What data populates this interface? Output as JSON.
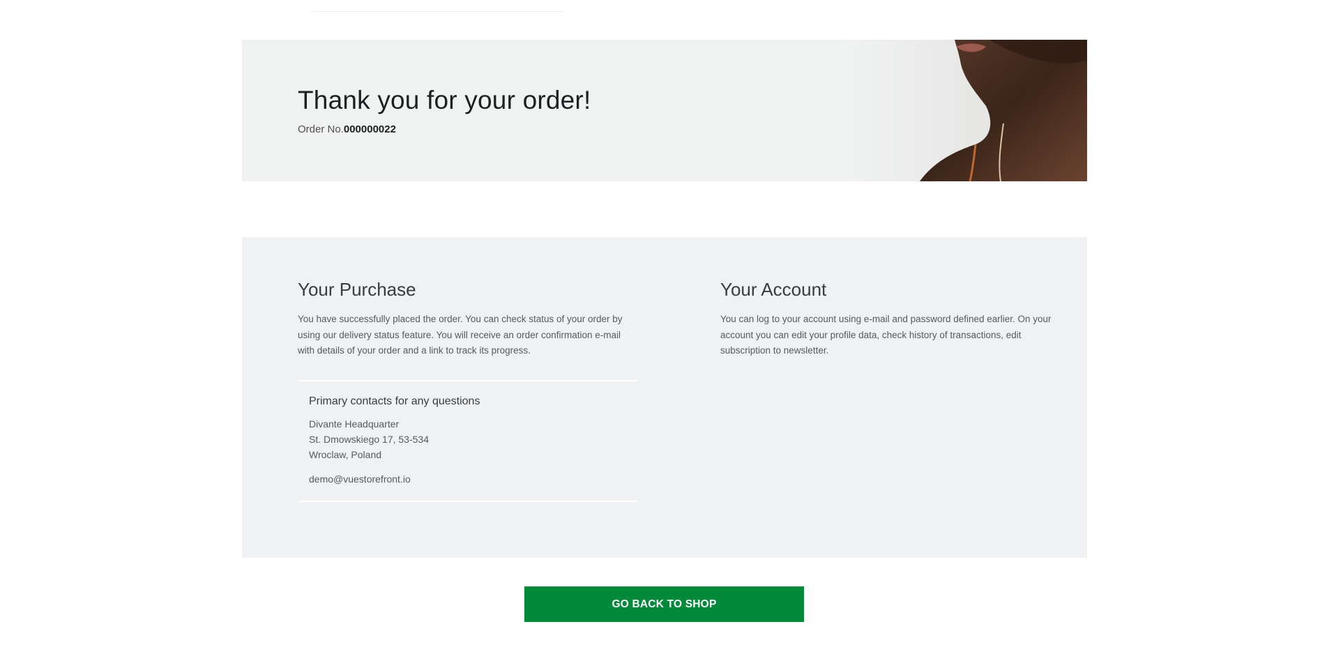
{
  "hero": {
    "title": "Thank you for your order!",
    "order_prefix": "Order No.",
    "order_number": "000000022"
  },
  "purchase": {
    "title": "Your Purchase",
    "text": "You have successfully placed the order. You can check status of your order by using our delivery status feature. You will receive an order confirmation e-mail with details of your order and a link to track its progress.",
    "contacts": {
      "title": "Primary contacts for any questions",
      "company": "Divante Headquarter",
      "street": "St. Dmowskiego 17, 53-534",
      "city": "Wroclaw, Poland",
      "email": "demo@vuestorefront.io"
    }
  },
  "account": {
    "title": "Your Account",
    "text": "You can log to your account using e-mail and password defined earlier. On your account you can edit your profile data, check history of transactions, edit subscription to newsletter."
  },
  "actions": {
    "back_label": "GO BACK TO SHOP"
  },
  "colors": {
    "accent": "#028a3b",
    "hero_bg": "#f0f2f1",
    "panel_bg": "#f0f1f2"
  }
}
